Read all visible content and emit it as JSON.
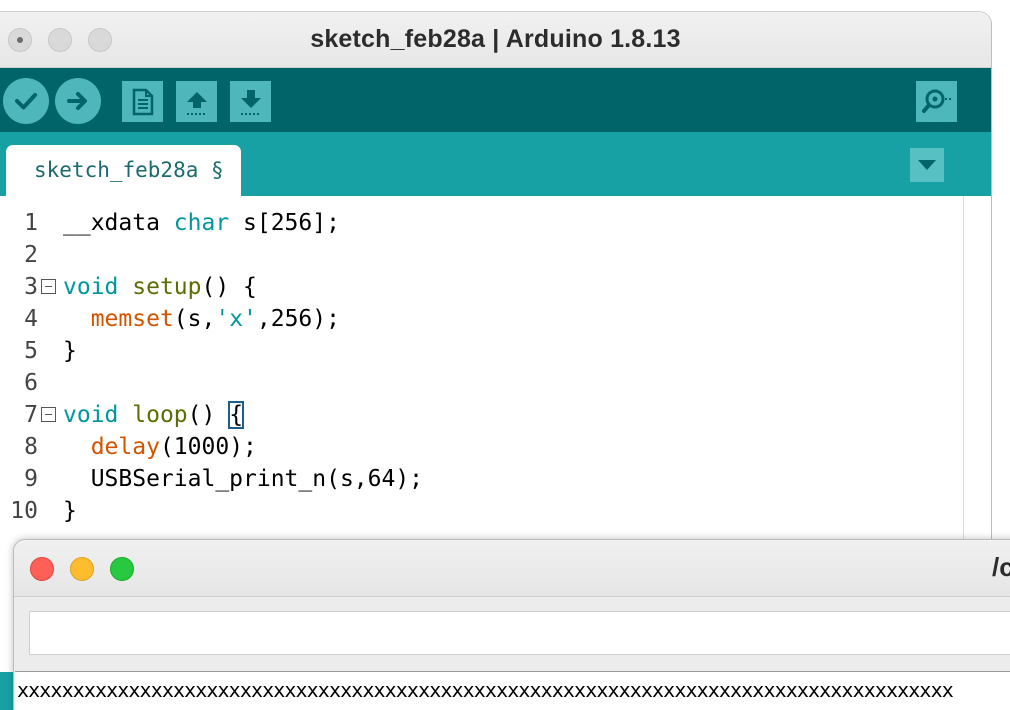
{
  "window": {
    "title": "sketch_feb28a | Arduino 1.8.13"
  },
  "toolbar": {
    "buttons": [
      {
        "name": "verify",
        "icon": "check-icon"
      },
      {
        "name": "upload",
        "icon": "arrow-right-icon"
      },
      {
        "name": "new",
        "icon": "new-document-icon"
      },
      {
        "name": "open",
        "icon": "arrow-up-icon"
      },
      {
        "name": "save",
        "icon": "arrow-down-icon"
      },
      {
        "name": "serial-monitor",
        "icon": "magnifier-icon"
      }
    ]
  },
  "tabs": [
    {
      "label": "sketch_feb28a §",
      "active": true
    }
  ],
  "editor": {
    "line_numbers": [
      "1",
      "2",
      "3",
      "4",
      "5",
      "6",
      "7",
      "8",
      "9",
      "10"
    ],
    "lines": [
      [
        {
          "t": "__xdata ",
          "c": ""
        },
        {
          "t": "char",
          "c": "kw"
        },
        {
          "t": " s[256];",
          "c": ""
        }
      ],
      [],
      [
        {
          "t": "void",
          "c": "kw"
        },
        {
          "t": " ",
          "c": ""
        },
        {
          "t": "setup",
          "c": "fn"
        },
        {
          "t": "() {",
          "c": ""
        }
      ],
      [
        {
          "t": "  ",
          "c": ""
        },
        {
          "t": "memset",
          "c": "fn2"
        },
        {
          "t": "(s,",
          "c": ""
        },
        {
          "t": "'x'",
          "c": "str"
        },
        {
          "t": ",256);",
          "c": ""
        }
      ],
      [
        {
          "t": "}",
          "c": ""
        }
      ],
      [],
      [
        {
          "t": "void",
          "c": "kw"
        },
        {
          "t": " ",
          "c": ""
        },
        {
          "t": "loop",
          "c": "fn"
        },
        {
          "t": "() ",
          "c": ""
        },
        {
          "t": "{",
          "c": "cursor"
        }
      ],
      [
        {
          "t": "  ",
          "c": ""
        },
        {
          "t": "delay",
          "c": "fn2"
        },
        {
          "t": "(1000);",
          "c": ""
        }
      ],
      [
        {
          "t": "  USBSerial_print_n(s,64);",
          "c": ""
        }
      ],
      [
        {
          "t": "}",
          "c": ""
        }
      ]
    ]
  },
  "serial_monitor": {
    "title": "/c",
    "input_value": "",
    "output": "xxxxxxxxxxxxxxxxxxxxxxxxxxxxxxxxxxxxxxxxxxxxxxxxxxxxxxxxxxxxxxxxxxxxxxxxxxxxxxxxxxxx"
  },
  "colors": {
    "toolbar": "#006468",
    "tabbar": "#17a1a5",
    "button": "#4db7bb",
    "keyword": "#00979c",
    "function": "#5e6d03",
    "builtin": "#d35400"
  }
}
